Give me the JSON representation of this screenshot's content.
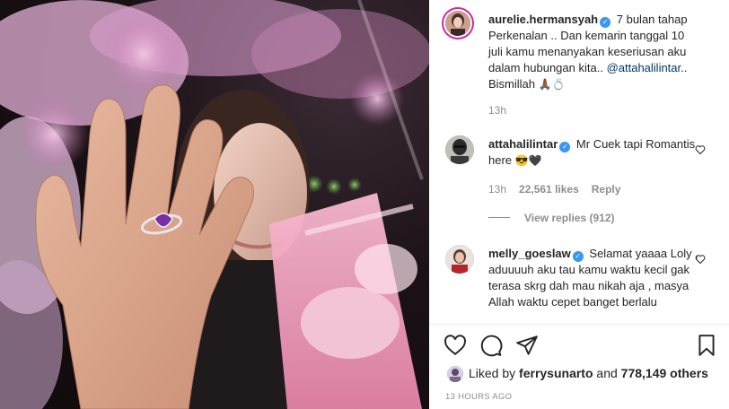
{
  "post": {
    "author": "aurelie.hermansyah",
    "caption_text": "7 bulan tahap Perkenalan .. Dan kemarin tanggal 10 juli kamu menanyakan keseriusan aku dalam hubungan kita..",
    "caption_mention": "@attahalilintar",
    "caption_end": ".. Bismillah",
    "caption_emoji": "🙏🏾💍",
    "time": "13h"
  },
  "comments": [
    {
      "user": "attahalilintar",
      "text": "Mr Cuek tapi Romantis here",
      "emoji": "😎🖤",
      "time": "13h",
      "likes": "22,561 likes",
      "reply": "Reply",
      "view_replies": "View replies (912)"
    },
    {
      "user": "melly_goeslaw",
      "text": "Selamat yaaaa Loly , aduuuuh aku tau kamu waktu kecil gak terasa skrg dah mau nikah aja , masya Allah waktu cepet banget berlalu"
    }
  ],
  "footer": {
    "liked_prefix": "Liked by",
    "liked_user": "ferrysunarto",
    "liked_and": "and",
    "liked_count": "778,149 others",
    "timestamp": "13 HOURS AGO"
  },
  "icons": {
    "like": "heart-icon",
    "comment": "comment-icon",
    "share": "share-icon",
    "save": "bookmark-icon",
    "verified": "verified-badge-icon"
  },
  "colors": {
    "verified": "#3897f0",
    "mention": "#00376b",
    "muted": "#8e8e8e",
    "text": "#262626"
  }
}
